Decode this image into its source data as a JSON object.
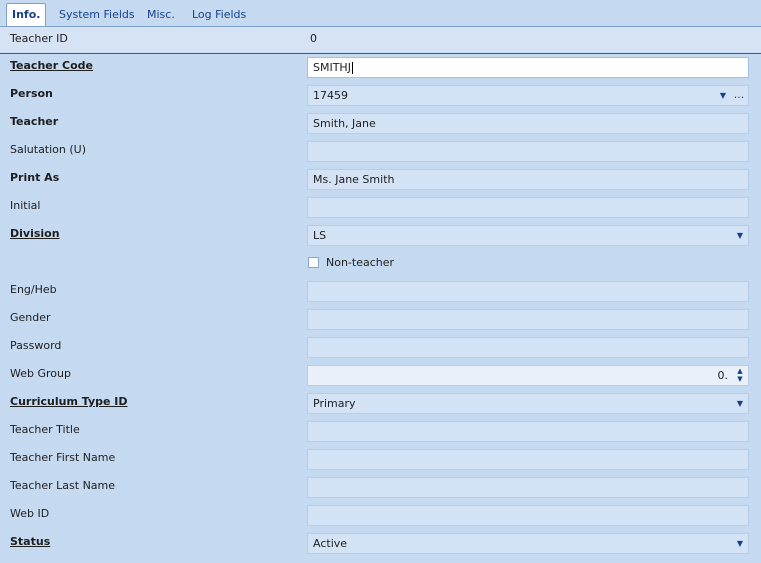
{
  "tabs": [
    "Info.",
    "System Fields",
    "Misc.",
    "Log Fields"
  ],
  "teacher_id": {
    "label": "Teacher ID",
    "value": "0"
  },
  "fields": {
    "teacher_code": {
      "label": "Teacher Code",
      "value": "SMITHJ"
    },
    "person": {
      "label": "Person",
      "value": "17459",
      "ellipsis": "..."
    },
    "teacher": {
      "label": "Teacher",
      "value": "Smith, Jane"
    },
    "salutation": {
      "label": "Salutation (U)",
      "value": ""
    },
    "print_as": {
      "label": "Print As",
      "value": "Ms. Jane Smith"
    },
    "initial": {
      "label": "Initial",
      "value": ""
    },
    "division": {
      "label": "Division",
      "value": "LS"
    },
    "non_teacher": {
      "label": "Non-teacher",
      "checked": false
    },
    "eng_heb": {
      "label": "Eng/Heb",
      "value": ""
    },
    "gender": {
      "label": "Gender",
      "value": ""
    },
    "password": {
      "label": "Password",
      "value": ""
    },
    "web_group": {
      "label": "Web Group",
      "value": "0."
    },
    "curriculum_type_id": {
      "label": "Curriculum Type ID",
      "value": "Primary"
    },
    "teacher_title": {
      "label": "Teacher Title",
      "value": ""
    },
    "teacher_first_name": {
      "label": "Teacher First Name",
      "value": ""
    },
    "teacher_last_name": {
      "label": "Teacher Last Name",
      "value": ""
    },
    "web_id": {
      "label": "Web ID",
      "value": ""
    },
    "status": {
      "label": "Status",
      "value": "Active"
    }
  },
  "icons": {
    "dropdown": "chevron-down-icon",
    "spin_up": "spin-up-icon",
    "spin_down": "spin-down-icon"
  },
  "colors": {
    "background": "#c5d9f1",
    "field": "#d3e2f5",
    "field_border": "#b9cde6",
    "tab_text": "#15428b"
  }
}
